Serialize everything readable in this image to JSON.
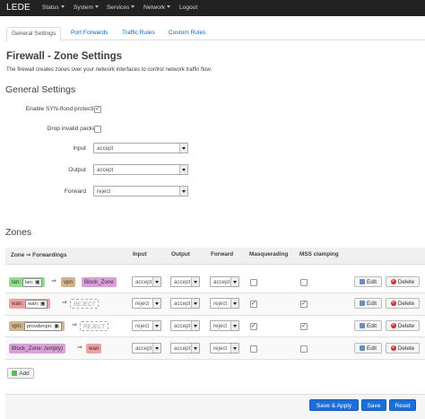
{
  "brand": "LEDE",
  "nav": {
    "status": "Status",
    "system": "System",
    "services": "Services",
    "network": "Network",
    "logout": "Logout"
  },
  "tabs": [
    "General Settings",
    "Port Forwards",
    "Traffic Rules",
    "Custom Rules"
  ],
  "page": {
    "title": "Firewall - Zone Settings",
    "description": "The firewall creates zones over your network interfaces to control network traffic flow."
  },
  "general": {
    "title": "General Settings",
    "syn_flood_label": "Enable SYN-flood protection",
    "syn_flood_checked": true,
    "drop_invalid_label": "Drop invalid packets",
    "drop_invalid_checked": false,
    "input_label": "Input",
    "input_value": "accept",
    "output_label": "Output",
    "output_value": "accept",
    "forward_label": "Forward",
    "forward_value": "reject"
  },
  "zones": {
    "title": "Zones",
    "headers": {
      "forwardings": "Zone ⇒ Forwardings",
      "input": "Input",
      "output": "Output",
      "forward": "Forward",
      "masq": "Masquerading",
      "mss": "MSS clamping"
    },
    "rows": [
      {
        "zone": "lan:",
        "interface": "lan:",
        "iface_icon": "network-icon",
        "arrow": "⇒",
        "targets": [
          {
            "name": "vpn",
            "dashed": false,
            "color": "#d2b48c"
          },
          {
            "name": "Block_Zone",
            "dashed": false,
            "color": "#daa0da"
          }
        ],
        "zone_color": "#90e090",
        "input": "accept",
        "output": "accept",
        "forward": "accept",
        "masq": false,
        "mss": false
      },
      {
        "zone": "wan:",
        "interface": "wan:",
        "iface_icon": "network-icon",
        "arrow": "⇒",
        "targets": [
          {
            "name": "REJECT",
            "dashed": true,
            "color": "#ffffff"
          }
        ],
        "zone_color": "#f0a0a0",
        "input": "reject",
        "output": "accept",
        "forward": "reject",
        "masq": true,
        "mss": true
      },
      {
        "zone": "vpn:",
        "interface": "provdenpn:",
        "iface_icon": "network-icon",
        "arrow": "⇒",
        "targets": [
          {
            "name": "REJECT",
            "dashed": true,
            "color": "#ffffff"
          }
        ],
        "zone_color": "#d2b48c",
        "input": "reject",
        "output": "accept",
        "forward": "reject",
        "masq": true,
        "mss": true
      },
      {
        "zone": "Block_Zone:",
        "interface": "(empty)",
        "iface_icon": "",
        "arrow": "⇒",
        "targets": [
          {
            "name": "wan",
            "dashed": false,
            "color": "#f0a0a0"
          }
        ],
        "zone_color": "#daa0da",
        "input": "accept",
        "output": "accept",
        "forward": "reject",
        "masq": false,
        "mss": false
      }
    ],
    "edit_label": "Edit",
    "delete_label": "Delete",
    "add_label": "Add"
  },
  "footer": {
    "save_apply": "Save & Apply",
    "save": "Save",
    "reset": "Reset"
  },
  "colors": {
    "navbar": "#222222",
    "primary_button": "#1d6ed8",
    "link": "#0069d6"
  }
}
